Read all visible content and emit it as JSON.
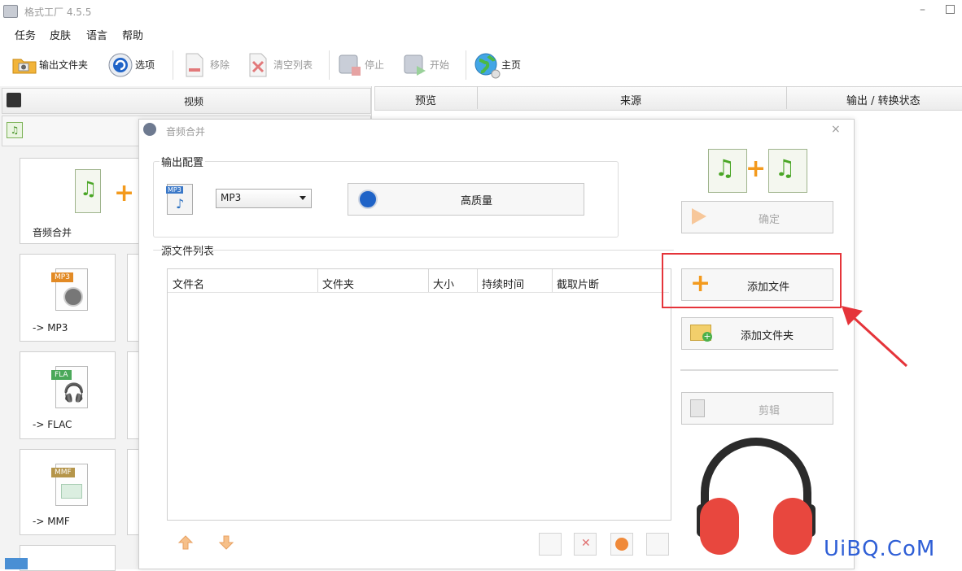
{
  "app": {
    "title": "格式工厂 4.5.5"
  },
  "menu": [
    "任务",
    "皮肤",
    "语言",
    "帮助"
  ],
  "toolbar": {
    "output_folder": "输出文件夹",
    "options": "选项",
    "remove": "移除",
    "clear_list": "清空列表",
    "stop": "停止",
    "start": "开始",
    "home": "主页"
  },
  "left": {
    "category_video": "视频",
    "tiles": [
      {
        "label": "音频合并"
      },
      {
        "label": "-> MP3",
        "tag": "MP3"
      },
      {
        "label": "-> FLAC",
        "tag": "FLA"
      },
      {
        "label": "-> MMF",
        "tag": "MMF"
      }
    ]
  },
  "main_table": {
    "columns": [
      "预览",
      "来源",
      "输出 / 转换状态"
    ]
  },
  "dialog": {
    "title": "音频合并",
    "close": "×",
    "output_group": "输出配置",
    "format_value": "MP3",
    "quality_label": "高质量",
    "source_group": "源文件列表",
    "file_columns": [
      "文件名",
      "文件夹",
      "大小",
      "持续时间",
      "截取片断"
    ],
    "buttons": {
      "confirm": "确定",
      "add_file": "添加文件",
      "add_folder": "添加文件夹",
      "cut": "剪辑"
    }
  },
  "colors": {
    "highlight": "#e5343a",
    "arrow": "#e5343a",
    "plus": "#f39a1d",
    "headphones": "#e8473e",
    "watermark": "#2f5fd6"
  },
  "watermark": "UiBQ.CoM"
}
